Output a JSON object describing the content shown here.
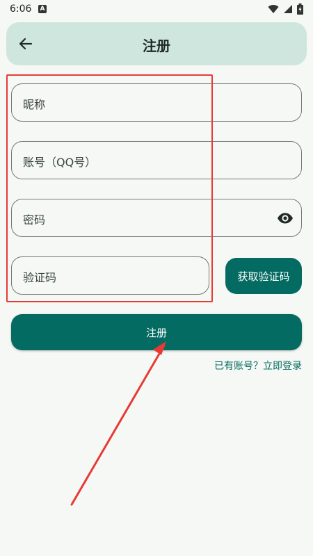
{
  "status_bar": {
    "time": "6:06",
    "notification_glyph": "A",
    "icons": [
      "wifi-icon",
      "signal-icon",
      "battery-icon"
    ]
  },
  "app_bar": {
    "title": "注册",
    "back_icon": "arrow-left-icon"
  },
  "form": {
    "nickname_placeholder": "昵称",
    "account_placeholder": "账号（QQ号）",
    "password_placeholder": "密码",
    "password_toggle_icon": "eye-icon",
    "code_placeholder": "验证码",
    "get_code_label": "获取验证码",
    "register_label": "注册",
    "login_link": "已有账号？立即登录"
  },
  "colors": {
    "primary": "#036b61",
    "app_bar": "#cfe6df",
    "background": "#f6f8f5",
    "annotation": "#e83a35"
  }
}
